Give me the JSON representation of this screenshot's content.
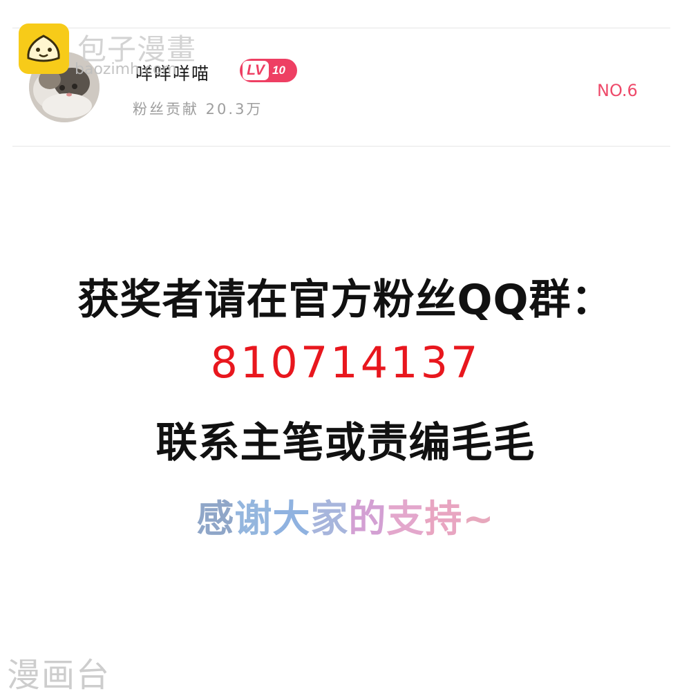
{
  "user": {
    "name": "咩咩咩喵",
    "level_prefix": "LV",
    "level_value": "10",
    "fan_contribution": "粉丝贡献 20.3万",
    "rank": "NO.6"
  },
  "message": {
    "line1": "获奖者请在官方粉丝QQ群：",
    "qq_number": "810714137",
    "line3": "联系主笔或责编毛毛",
    "thanks_chars": [
      "感",
      "谢",
      "大",
      "家",
      "的",
      "支",
      "持",
      "~"
    ]
  },
  "watermarks": {
    "top_title": "包子漫畫",
    "top_url": "baozimh.com",
    "bottom": "漫画台"
  },
  "colors": {
    "badge": "#ee3f63",
    "rank": "#ee4a6a",
    "qq_number": "#e8171e",
    "thanks_gradient": [
      "#8fa6c8",
      "#94b6de",
      "#8fb2e0",
      "#a7b5dc",
      "#d3a0d3",
      "#e3a7cc",
      "#e8a5c1",
      "#e7a8bd"
    ]
  }
}
